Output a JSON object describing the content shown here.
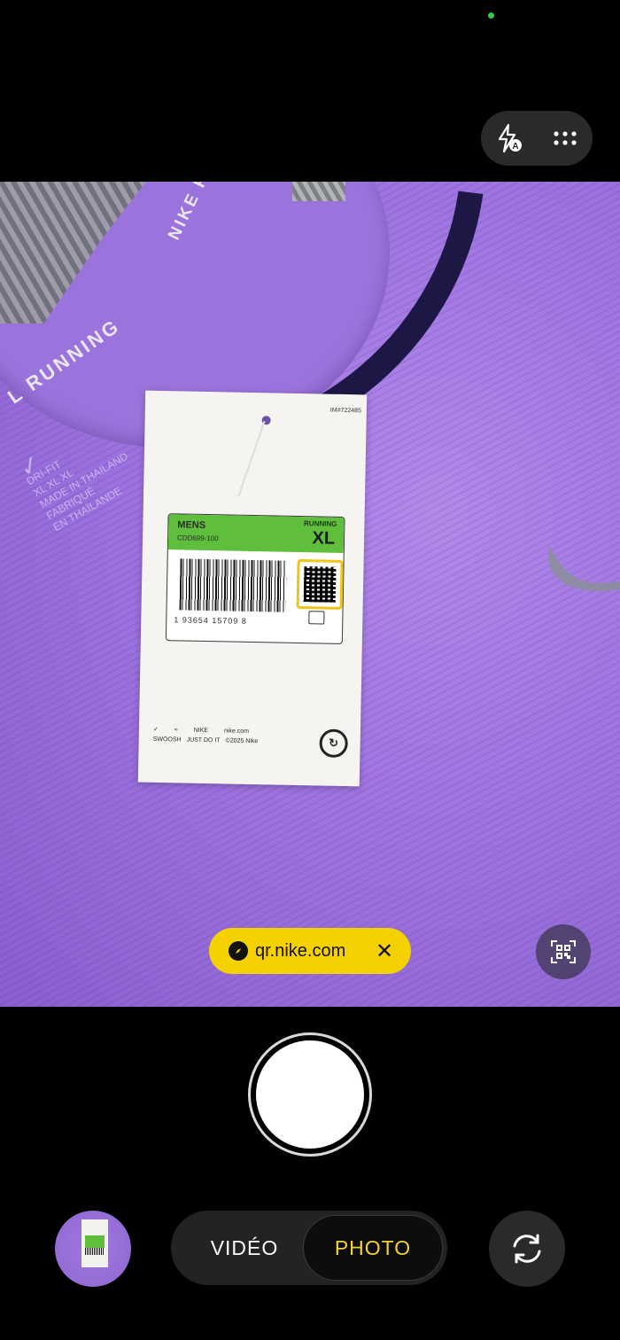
{
  "top_bar": {
    "flash_icon": "flash-auto-icon",
    "more_icon": "more-options-icon"
  },
  "scene": {
    "neck_text_vertical": "NIKE R",
    "neck_text_curve": "L RUNNING",
    "inner_label_lines": [
      "DRI-FIT",
      "XL   XL   XL",
      "MADE IN THAILAND",
      "FABRIQUÉ",
      "EN THAÏLANDE"
    ],
    "tag": {
      "id": "IM#722485",
      "gender": "MENS",
      "style_code": "CDD699-100",
      "category": "RUNNING",
      "size": "XL",
      "barcode_digits": "1  93654 15709  8",
      "bottom_labels": [
        "SWOOSH",
        "JUST DO IT",
        "©2025 Nike"
      ],
      "brand_labels": [
        "NIKE",
        "nike.com"
      ]
    }
  },
  "qr_detection": {
    "url": "qr.nike.com",
    "close_symbol": "✕"
  },
  "modes": {
    "video_label": "VIDÉO",
    "photo_label": "PHOTO",
    "active": "PHOTO"
  },
  "colors": {
    "active_mode": "#f2d236",
    "qr_chip": "#f6d100",
    "shirt": "#9e74e0",
    "status_dot": "#2ecc40"
  }
}
